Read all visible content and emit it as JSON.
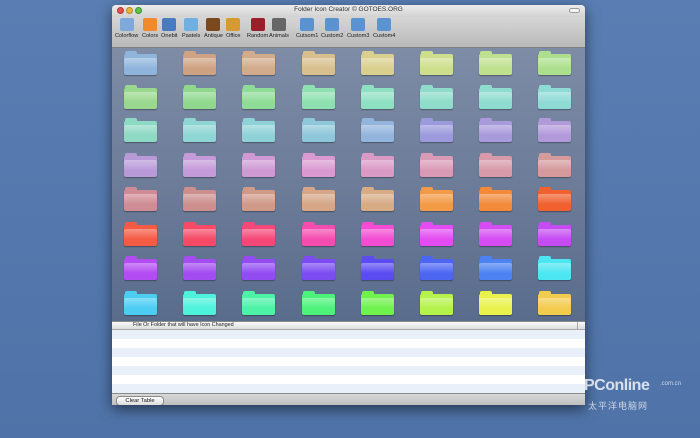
{
  "window": {
    "title": "Folder Icon Creator © GOTOES.ORG"
  },
  "toolbar": {
    "items": [
      {
        "label": "Colorflow",
        "icon": "colorflow-icon",
        "color": "#7fa9d8"
      },
      {
        "label": "Colors",
        "icon": "colors-icon",
        "color": "#f08a2c"
      },
      {
        "label": "Onebit",
        "icon": "onebit-icon",
        "color": "#4a7bc0"
      },
      {
        "label": "Pastels",
        "icon": "pastels-icon",
        "color": "#6fb0e0"
      },
      {
        "label": "Antique",
        "icon": "antique-icon",
        "color": "#7a4a1e"
      },
      {
        "label": "Office",
        "icon": "office-icon",
        "color": "#d79a32"
      },
      {
        "label": "Random",
        "icon": "random-icon",
        "color": "#9b1f2a"
      },
      {
        "label": "Animals",
        "icon": "animals-icon",
        "color": "#666666"
      },
      {
        "label": "Cutsom1",
        "icon": "folder-icon",
        "color": "#5b93d0"
      },
      {
        "label": "Custom2",
        "icon": "folder-icon",
        "color": "#5b93d0"
      },
      {
        "label": "Custom3",
        "icon": "folder-icon",
        "color": "#5b93d0"
      },
      {
        "label": "Custom4",
        "icon": "folder-icon",
        "color": "#5b93d0"
      }
    ]
  },
  "folders": {
    "rows": [
      [
        "#8fb5dc",
        "#cfa283",
        "#d2ab8c",
        "#d8c08e",
        "#d9cf8e",
        "#cddf8d",
        "#bfe08e",
        "#ade08e"
      ],
      [
        "#99d88e",
        "#8fd88e",
        "#8edc98",
        "#8ee0b0",
        "#8ee0c2",
        "#8edcc9",
        "#8edccf",
        "#8edbd6"
      ],
      [
        "#8ed9c3",
        "#8ed6d3",
        "#8ed2d8",
        "#8ec7da",
        "#93b4dc",
        "#9c9adc",
        "#a89adb",
        "#b299da"
      ],
      [
        "#b89ad9",
        "#c49ad9",
        "#cf9ad4",
        "#da9ad1",
        "#da9ac6",
        "#d99ab6",
        "#d79aa8",
        "#d49a9c"
      ],
      [
        "#d08c94",
        "#cd8e8e",
        "#cf9a88",
        "#d6a686",
        "#d7ab84",
        "#f39a47",
        "#f28a3a",
        "#f0612f"
      ],
      [
        "#f45b44",
        "#f64a67",
        "#f54878",
        "#f44caf",
        "#f44cd2",
        "#e34cf2",
        "#d44cf2",
        "#c54cf2"
      ],
      [
        "#b34cf2",
        "#a24cf2",
        "#934cf2",
        "#7c4cf2",
        "#5b4cf2",
        "#4c66f2",
        "#4c82f2",
        "#4ce6f2"
      ],
      [
        "#4ccdf2",
        "#4cf2da",
        "#4cf2a6",
        "#4cf27a",
        "#6ff24c",
        "#b6f24c",
        "#e9f24c",
        "#f2cc4c"
      ]
    ]
  },
  "table": {
    "column_header": "File Or Folder that will have Icon Changed",
    "rows": []
  },
  "bottombar": {
    "clear_label": "Clear Table"
  },
  "watermark": {
    "brand": "PConline",
    "domain": ".com.cn",
    "cn": "太平洋电脑网"
  }
}
